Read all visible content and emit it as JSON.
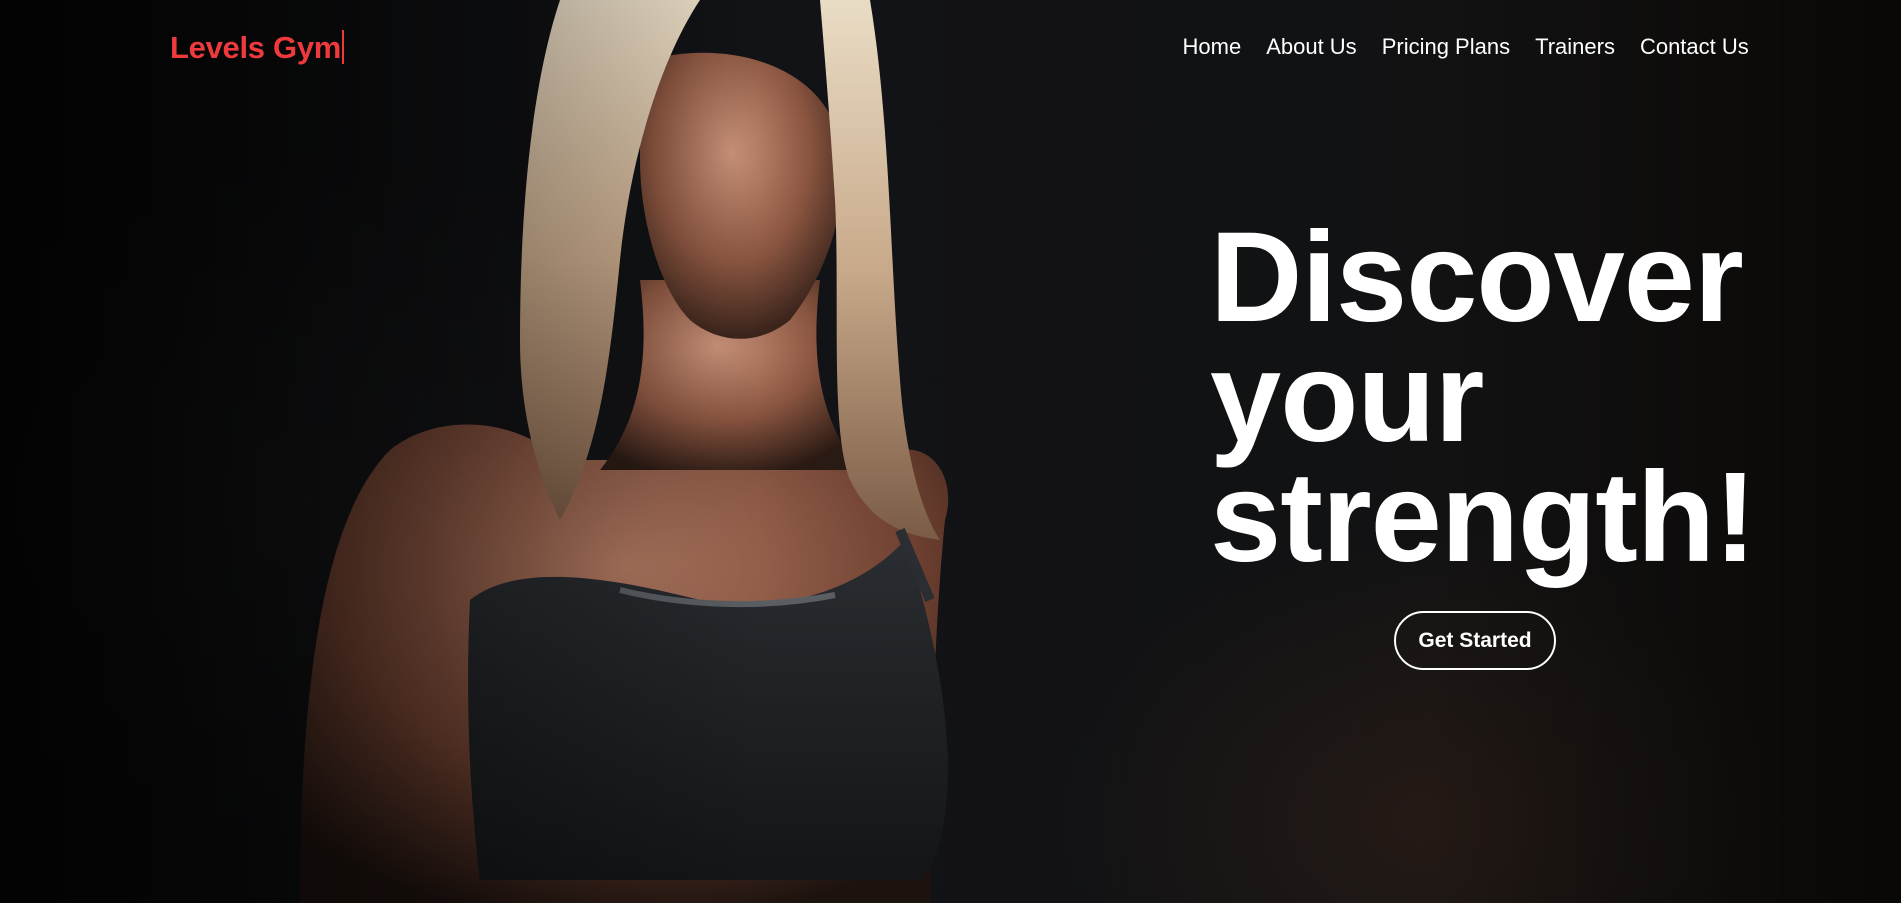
{
  "brand": {
    "name": "Levels Gym",
    "color": "#ee3a3d"
  },
  "nav": {
    "items": [
      {
        "label": "Home"
      },
      {
        "label": "About Us"
      },
      {
        "label": "Pricing Plans"
      },
      {
        "label": "Trainers"
      },
      {
        "label": "Contact Us"
      }
    ]
  },
  "hero": {
    "headline_lines": [
      "Discover",
      "your",
      "strength!"
    ],
    "cta_label": "Get Started",
    "photo_subject": "woman-athlete-photo"
  },
  "colors": {
    "background": "#0b0c0e",
    "text": "#ffffff",
    "accent": "#ee3a3d"
  }
}
